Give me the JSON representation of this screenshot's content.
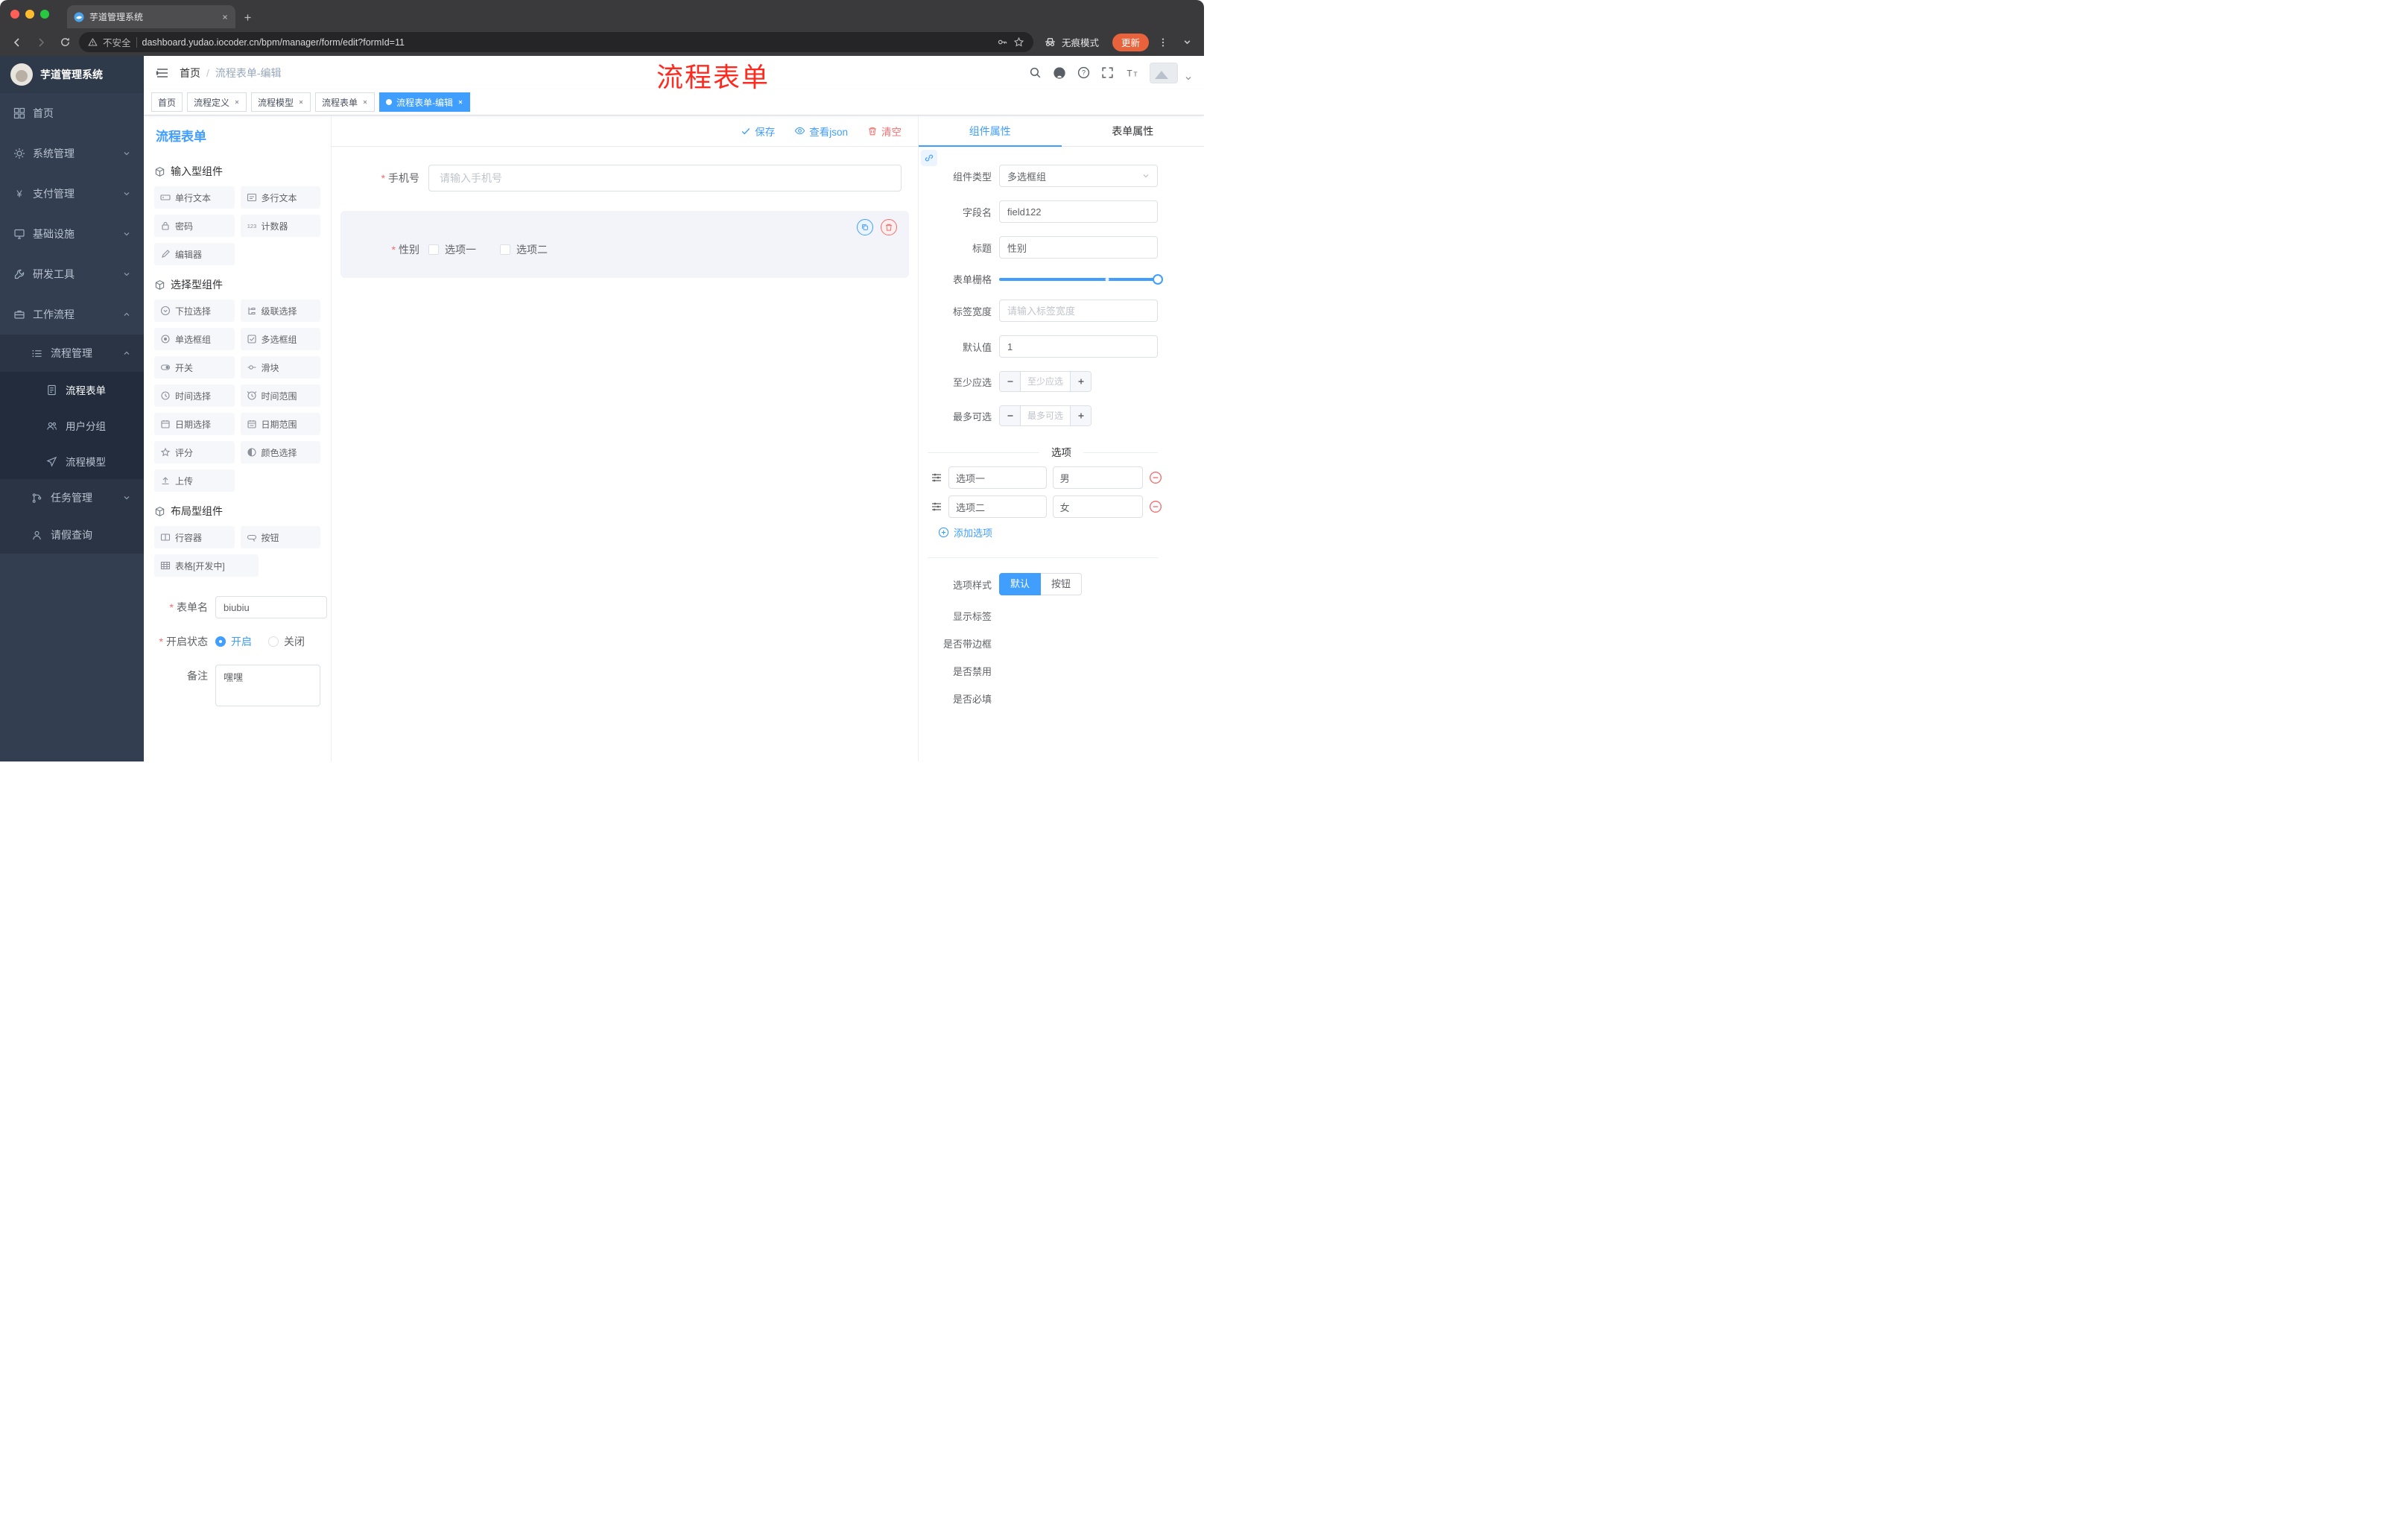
{
  "browser": {
    "tab_title": "芋道管理系统",
    "security_label": "不安全",
    "url": "dashboard.yudao.iocoder.cn/bpm/manager/form/edit?formId=11",
    "incognito_label": "无痕模式",
    "update_label": "更新"
  },
  "annotation_text": "流程表单",
  "header": {
    "breadcrumb_home": "首页",
    "breadcrumb_sep": "/",
    "breadcrumb_current": "流程表单-编辑"
  },
  "sidebar": {
    "logo_title": "芋道管理系统",
    "items": {
      "home": "首页",
      "system": "系统管理",
      "payment": "支付管理",
      "infra": "基础设施",
      "devtools": "研发工具",
      "workflow": "工作流程",
      "process_mgmt": "流程管理",
      "process_form": "流程表单",
      "user_group": "用户分组",
      "process_model": "流程模型",
      "task_mgmt": "任务管理",
      "leave_query": "请假查询"
    }
  },
  "tags": {
    "t0": "首页",
    "t1": "流程定义",
    "t2": "流程模型",
    "t3": "流程表单",
    "t4": "流程表单-编辑"
  },
  "palette": {
    "title": "流程表单",
    "section_input": "输入型组件",
    "section_select": "选择型组件",
    "section_layout": "布局型组件",
    "items": {
      "single_text": "单行文本",
      "multi_text": "多行文本",
      "password": "密码",
      "counter": "计数器",
      "editor": "编辑器",
      "select": "下拉选择",
      "cascader": "级联选择",
      "radio_group": "单选框组",
      "checkbox_group": "多选框组",
      "switch": "开关",
      "slider": "滑块",
      "time_picker": "时间选择",
      "time_range": "时间范围",
      "date_picker": "日期选择",
      "date_range": "日期范围",
      "rate": "评分",
      "color_picker": "颜色选择",
      "upload": "上传",
      "row_container": "行容器",
      "button": "按钮",
      "table_dev": "表格[开发中]"
    },
    "form": {
      "name_label": "表单名",
      "name_value": "biubiu",
      "status_label": "开启状态",
      "status_on": "开启",
      "status_off": "关闭",
      "remark_label": "备注",
      "remark_value": "嘿嘿"
    }
  },
  "canvas": {
    "save": "保存",
    "view_json": "查看json",
    "clear": "清空",
    "phone_label": "手机号",
    "phone_placeholder": "请输入手机号",
    "gender_label": "性别",
    "gender_opt1": "选项一",
    "gender_opt2": "选项二"
  },
  "inspector": {
    "tab_component": "组件属性",
    "tab_form": "表单属性",
    "type_label": "组件类型",
    "type_value": "多选框组",
    "field_label": "字段名",
    "field_value": "field122",
    "title_label": "标题",
    "title_value": "性别",
    "grid_label": "表单栅格",
    "width_label": "标签宽度",
    "width_placeholder": "请输入标签宽度",
    "default_label": "默认值",
    "default_value": "1",
    "min_label": "至少应选",
    "min_placeholder": "至少应选",
    "max_label": "最多可选",
    "max_placeholder": "最多可选",
    "options_title": "选项",
    "opt1_label": "选项一",
    "opt1_value": "男",
    "opt2_label": "选项二",
    "opt2_value": "女",
    "add_option": "添加选项",
    "style_label": "选项样式",
    "style_default": "默认",
    "style_button": "按钮",
    "show_label": "显示标签",
    "border_label": "是否带边框",
    "disabled_label": "是否禁用",
    "required_label": "是否必填"
  },
  "colors": {
    "accent": "#409eff",
    "danger": "#f56c6c",
    "annotation": "#ff2a1f",
    "sidebar_bg": "#333e50"
  }
}
